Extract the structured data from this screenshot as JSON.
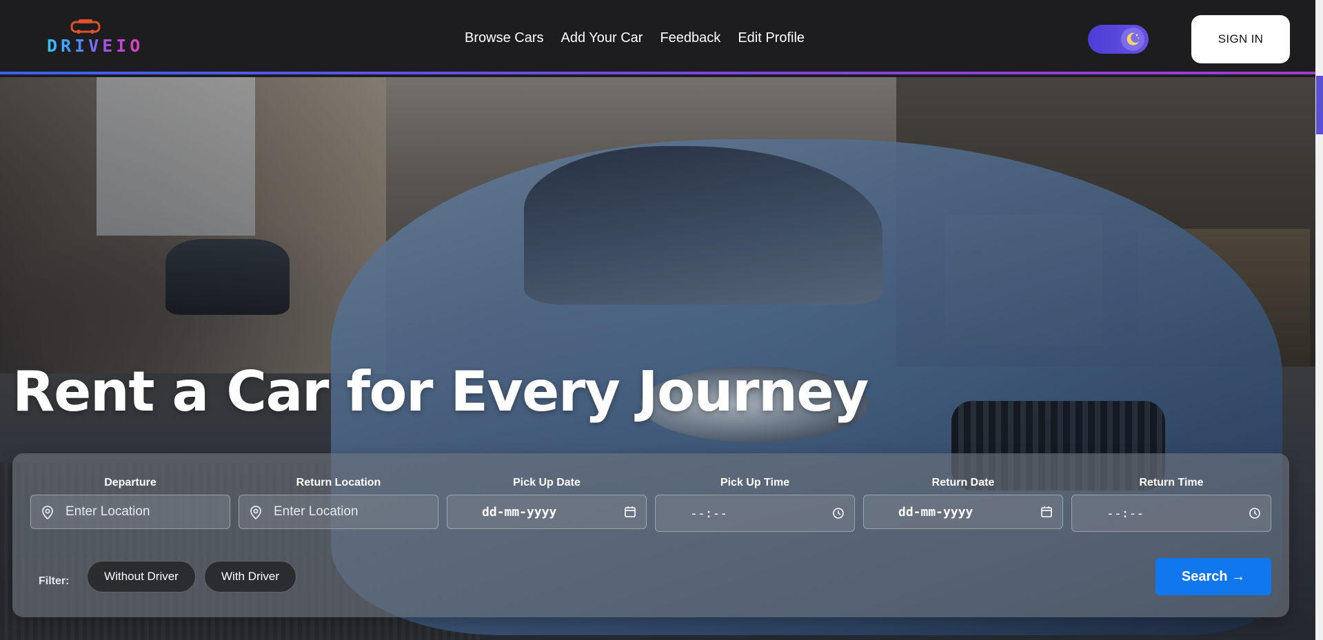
{
  "brand": {
    "name": "DRIVEIO"
  },
  "nav": {
    "links": [
      "Browse Cars",
      "Add Your Car",
      "Feedback",
      "Edit Profile"
    ],
    "theme_toggle_icon": "moon-icon",
    "signin_label": "SIGN IN"
  },
  "hero": {
    "headline": "Rent a Car for Every Journey"
  },
  "search": {
    "fields": [
      {
        "label": "Departure",
        "placeholder": "Enter Location",
        "type": "location"
      },
      {
        "label": "Return Location",
        "placeholder": "Enter Location",
        "type": "location"
      },
      {
        "label": "Pick Up Date",
        "value": "dd-mm-yyyy",
        "type": "date"
      },
      {
        "label": "Pick Up Time",
        "value": "--:--",
        "type": "time"
      },
      {
        "label": "Return Date",
        "value": "dd-mm-yyyy",
        "type": "date"
      },
      {
        "label": "Return Time",
        "value": "--:--",
        "type": "time"
      }
    ],
    "filter_label": "Filter:",
    "filters": [
      "Without Driver",
      "With Driver"
    ],
    "search_label": "Search →"
  },
  "colors": {
    "accent": "#1177ee",
    "toggle": "#4a3fd6",
    "navbar": "#1d1d1f",
    "nav_border_gradient": [
      "#3a63ff",
      "#a43bd6"
    ]
  }
}
